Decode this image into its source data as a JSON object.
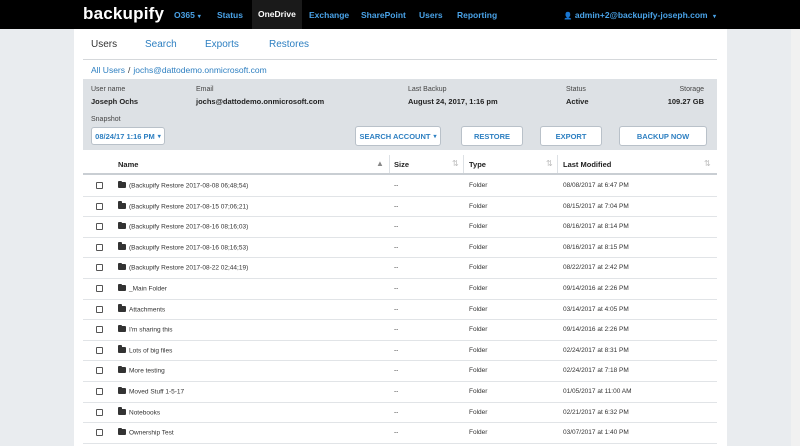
{
  "nav": {
    "logo": "backupify",
    "links": [
      {
        "label": "O365",
        "caret": "▾"
      },
      {
        "label": "Status"
      },
      {
        "label": "OneDrive"
      },
      {
        "label": "Exchange"
      },
      {
        "label": "SharePoint"
      },
      {
        "label": "Users"
      },
      {
        "label": "Reporting"
      }
    ],
    "user": "admin+2@backupify-joseph.com",
    "user_icon": "👤",
    "user_caret": "▾"
  },
  "subtabs": [
    "Users",
    "Search",
    "Exports",
    "Restores"
  ],
  "breadcrumb": {
    "root": "All Users",
    "sep": "/",
    "current": "jochs@dattodemo.onmicrosoft.com"
  },
  "info": {
    "username_label": "User name",
    "username": "Joseph Ochs",
    "email_label": "Email",
    "email": "jochs@dattodemo.onmicrosoft.com",
    "lastbackup_label": "Last Backup",
    "lastbackup": "August 24, 2017, 1:16 pm",
    "status_label": "Status",
    "status": "Active",
    "storage_label": "Storage",
    "storage": "109.27 GB"
  },
  "snapshot": {
    "label": "Snapshot",
    "value": "08/24/17 1:16 PM",
    "caret": "▾"
  },
  "actions": {
    "search": "SEARCH ACCOUNT",
    "search_caret": "▾",
    "restore": "RESTORE",
    "export": "EXPORT",
    "backup": "BACKUP NOW"
  },
  "table": {
    "headers": {
      "name": "Name",
      "size": "Size",
      "type": "Type",
      "modified": "Last Modified"
    },
    "sort_asc_icon": "▲",
    "sort_icon": "⇅",
    "rows": [
      {
        "name": "(Backupify Restore 2017-08-08 06;48;54)",
        "size": "--",
        "type": "Folder",
        "modified": "08/08/2017 at 6:47 PM"
      },
      {
        "name": "(Backupify Restore 2017-08-15 07;06;21)",
        "size": "--",
        "type": "Folder",
        "modified": "08/15/2017 at 7:04 PM"
      },
      {
        "name": "(Backupify Restore 2017-08-16 08;16;03)",
        "size": "--",
        "type": "Folder",
        "modified": "08/16/2017 at 8:14 PM"
      },
      {
        "name": "(Backupify Restore 2017-08-16 08;16;53)",
        "size": "--",
        "type": "Folder",
        "modified": "08/16/2017 at 8:15 PM"
      },
      {
        "name": "(Backupify Restore 2017-08-22 02;44;19)",
        "size": "--",
        "type": "Folder",
        "modified": "08/22/2017 at 2:42 PM"
      },
      {
        "name": "_Main Folder",
        "size": "--",
        "type": "Folder",
        "modified": "09/14/2016 at 2:26 PM"
      },
      {
        "name": "Attachments",
        "size": "--",
        "type": "Folder",
        "modified": "03/14/2017 at 4:05 PM"
      },
      {
        "name": "I'm sharing this",
        "size": "--",
        "type": "Folder",
        "modified": "09/14/2016 at 2:26 PM"
      },
      {
        "name": "Lots of big files",
        "size": "--",
        "type": "Folder",
        "modified": "02/24/2017 at 8:31 PM"
      },
      {
        "name": "More testing",
        "size": "--",
        "type": "Folder",
        "modified": "02/24/2017 at 7:18 PM"
      },
      {
        "name": "Moved Stuff 1-5-17",
        "size": "--",
        "type": "Folder",
        "modified": "01/05/2017 at 11:00 AM"
      },
      {
        "name": "Notebooks",
        "size": "--",
        "type": "Folder",
        "modified": "02/21/2017 at 6:32 PM"
      },
      {
        "name": "Ownership Test",
        "size": "--",
        "type": "Folder",
        "modified": "03/07/2017 at 1:40 PM"
      }
    ]
  }
}
